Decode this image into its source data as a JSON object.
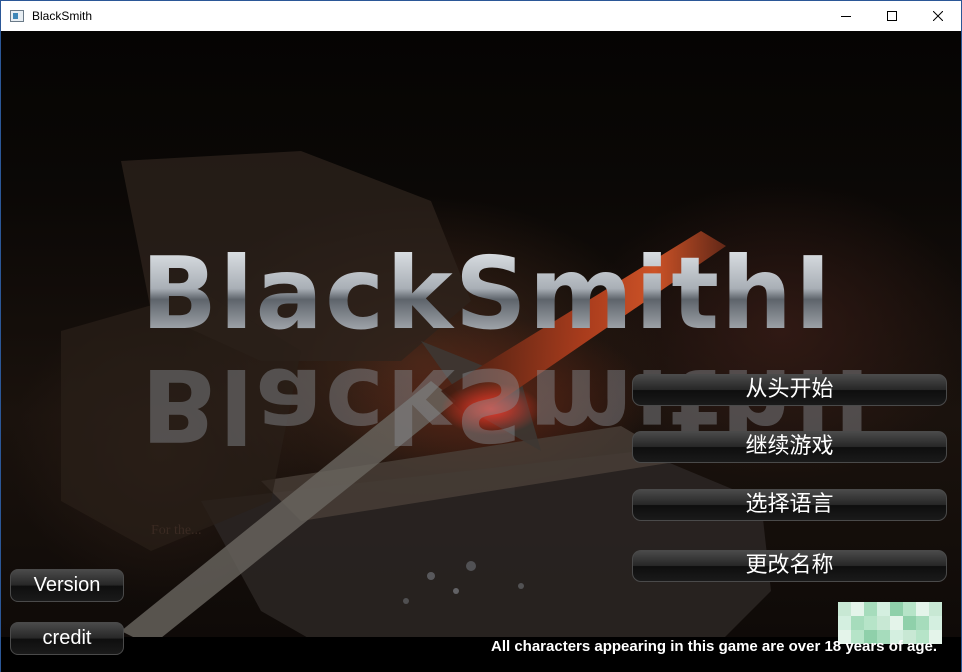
{
  "window": {
    "title": "BlackSmith",
    "controls": {
      "minimize": "minimize-icon",
      "maximize": "maximize-icon",
      "close": "close-icon"
    }
  },
  "game": {
    "logo": "BlackSmithII",
    "menu": [
      {
        "label": "从头开始",
        "id": "new-game"
      },
      {
        "label": "继续游戏",
        "id": "continue"
      },
      {
        "label": "选择语言",
        "id": "language"
      },
      {
        "label": "更改名称",
        "id": "rename"
      }
    ],
    "side_buttons": {
      "version": "Version",
      "credit": "credit"
    },
    "age_notice": "All characters appearing in this game are over 18 years of age.",
    "faint_caption": "For the..."
  },
  "colors": {
    "accent_window_border": "#2b5797",
    "button_text": "#ffffff",
    "mosaic": [
      "#c8e8d4",
      "#a6dcbc",
      "#e4f4ea",
      "#8fd0aa",
      "#d4efe0",
      "#b6e4c8"
    ]
  }
}
